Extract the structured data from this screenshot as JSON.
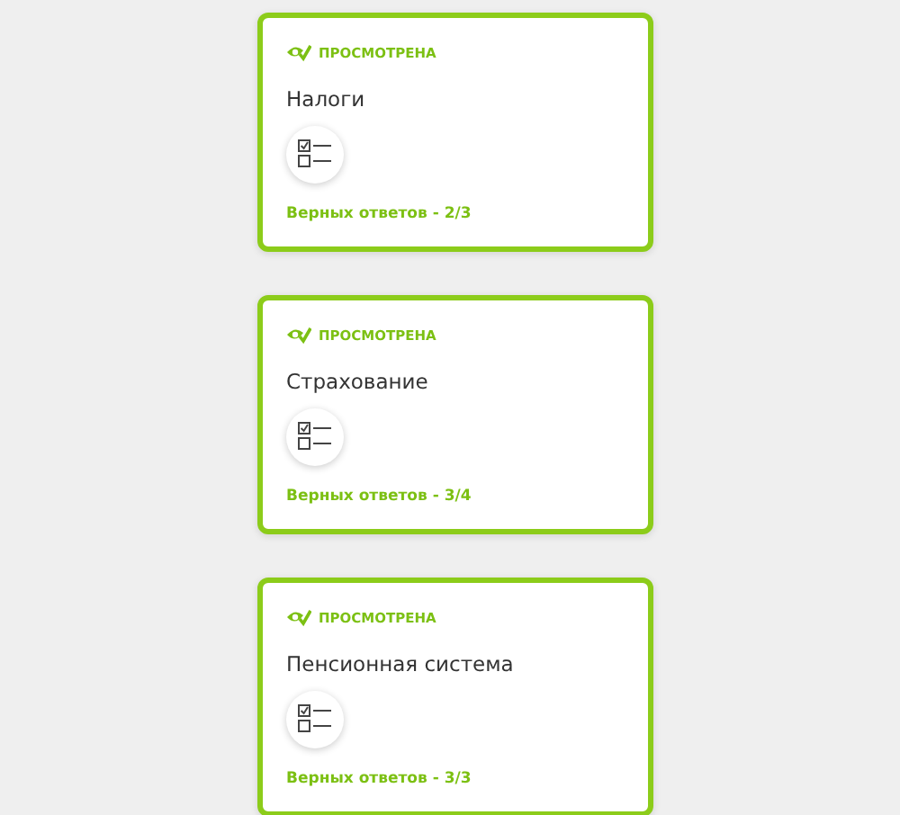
{
  "cards": [
    {
      "status": "ПРОСМОТРЕНА",
      "viewed": true,
      "title": "Налоги",
      "result": "Верных ответов - 2/3"
    },
    {
      "status": "ПРОСМОТРЕНА",
      "viewed": true,
      "title": "Страхование",
      "result": "Верных ответов - 3/4"
    },
    {
      "status": "ПРОСМОТРЕНА",
      "viewed": true,
      "title": "Пенсионная система",
      "result": "Верных ответов - 3/3"
    }
  ]
}
